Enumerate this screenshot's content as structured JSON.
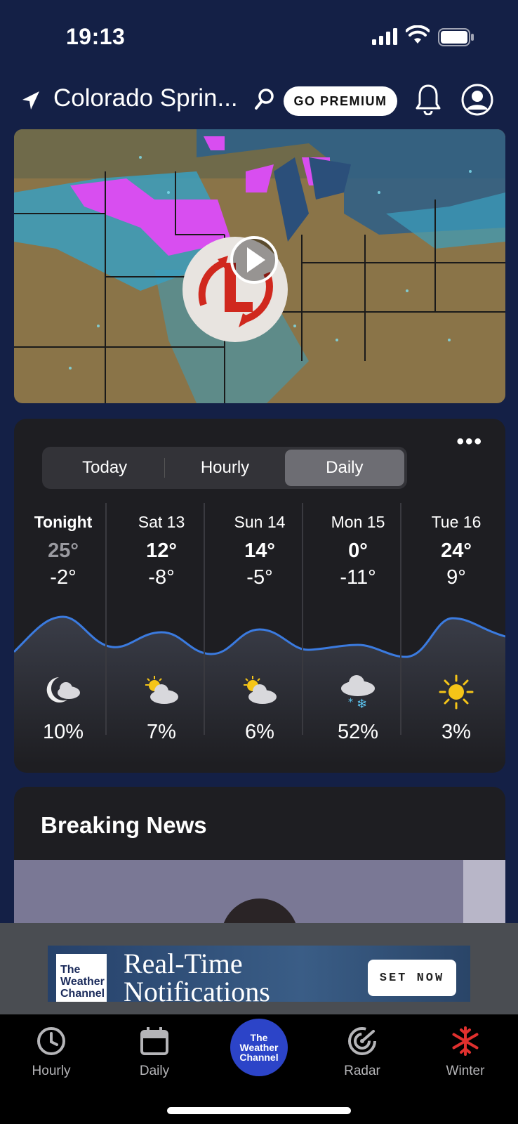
{
  "status_bar": {
    "time": "19:13"
  },
  "header": {
    "location": "Colorado Sprin...",
    "premium_label": "GO PREMIUM"
  },
  "forecast": {
    "tabs": [
      "Today",
      "Hourly",
      "Daily"
    ],
    "active_tab": "Daily",
    "more_label": "•••",
    "days": [
      {
        "label": "Tonight",
        "high": "25°",
        "low": "-2°",
        "icon": "moon-cloud-icon",
        "precip": "10%"
      },
      {
        "label": "Sat 13",
        "high": "12°",
        "low": "-8°",
        "icon": "partly-cloudy-icon",
        "precip": "7%"
      },
      {
        "label": "Sun 14",
        "high": "14°",
        "low": "-5°",
        "icon": "partly-cloudy-icon",
        "precip": "6%"
      },
      {
        "label": "Mon 15",
        "high": "0°",
        "low": "-11°",
        "icon": "snow-cloud-icon",
        "precip": "52%"
      },
      {
        "label": "Tue 16",
        "high": "24°",
        "low": "9°",
        "icon": "sun-icon",
        "precip": "3%"
      }
    ]
  },
  "news": {
    "title": "Breaking News"
  },
  "ad": {
    "logo_text": [
      "The",
      "Weather",
      "Channel"
    ],
    "headline": [
      "Real-Time",
      "Notifications"
    ],
    "button": "SET NOW"
  },
  "nav": {
    "items": [
      {
        "label": "Hourly",
        "icon": "clock-icon"
      },
      {
        "label": "Daily",
        "icon": "calendar-icon"
      },
      {
        "label": "Radar",
        "icon": "radar-icon"
      },
      {
        "label": "Winter",
        "icon": "snowflake-icon"
      }
    ],
    "center_logo": [
      "The",
      "Weather",
      "Channel"
    ]
  },
  "colors": {
    "background": "#142046",
    "card": "#1e1e22",
    "accent_blue": "#3b7be0",
    "nav_center": "#2c44c8",
    "winter_red": "#e0302e"
  }
}
